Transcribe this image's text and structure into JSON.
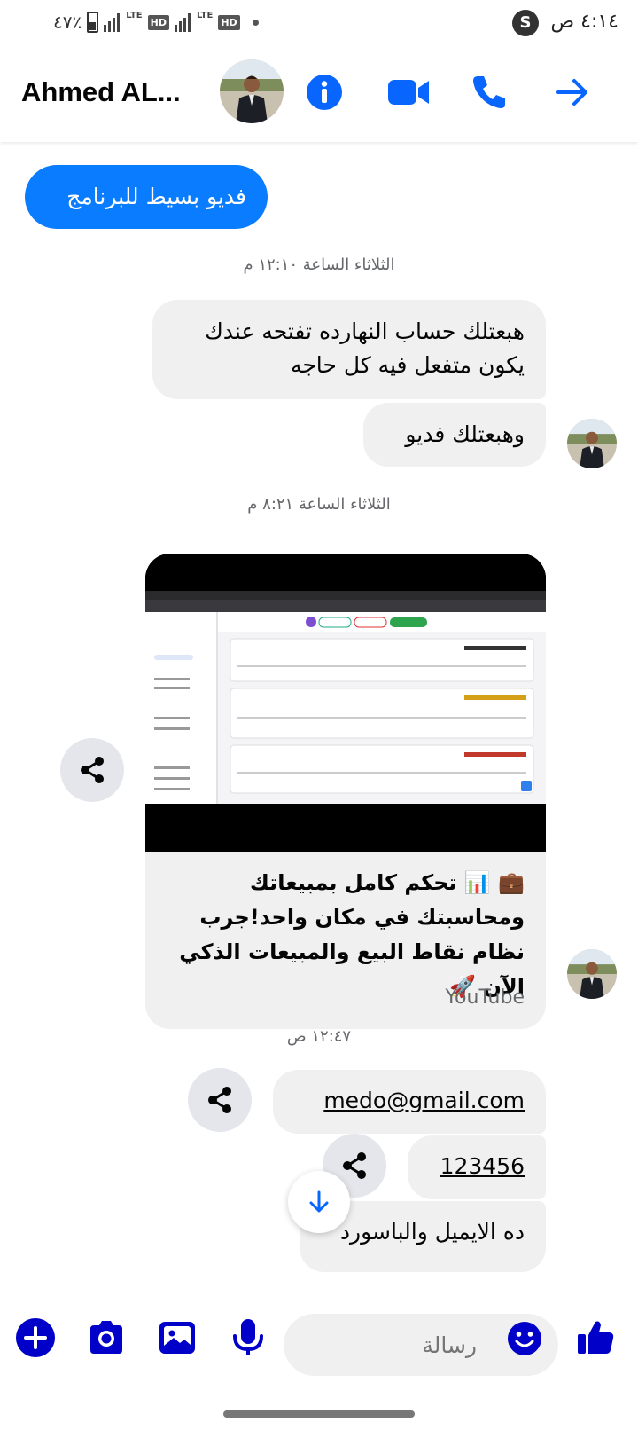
{
  "status_bar": {
    "time": "٤:١٤ ص",
    "battery_pct": "٤٧٪",
    "app_icon": "S",
    "net_labels": [
      "LTE",
      "HD",
      "LTE",
      "HD"
    ]
  },
  "header": {
    "contact_name": "Ahmed AL...",
    "icons": [
      "info-icon",
      "video-call-icon",
      "phone-icon",
      "arrow-right-icon"
    ]
  },
  "conversation": {
    "messages": [
      {
        "type": "sent",
        "text": "فديو بسيط للبرنامج"
      },
      {
        "type": "timestamp",
        "text": "الثلاثاء الساعة ١٢:١٠ م"
      },
      {
        "type": "received",
        "text": "هبعتلك حساب النهارده تفتحه عندك يكون متفعل فيه كل حاجه"
      },
      {
        "type": "received",
        "text": "وهبعتلك فديو"
      },
      {
        "type": "timestamp",
        "text": "الثلاثاء الساعة ٨:٢١ م"
      },
      {
        "type": "received_link",
        "text": "💼 📊 تحكم كامل بمبيعاتك ومحاسبتك في مكان واحد!جرب نظام نقاط البيع والمبيعات الذكي الآن 🚀",
        "source": "YouTube"
      },
      {
        "type": "timestamp",
        "text": "١٢:٤٧ ص"
      },
      {
        "type": "received",
        "text": "medo@gmail.com"
      },
      {
        "type": "received",
        "text": "123456"
      },
      {
        "type": "received",
        "text": "ده الايميل والباسورد"
      }
    ]
  },
  "composer": {
    "placeholder": "رسالة",
    "icons": [
      "add-icon",
      "camera-icon",
      "gallery-icon",
      "microphone-icon",
      "emoji-icon",
      "thumbs-up-icon"
    ]
  },
  "colors": {
    "accent": "#0a7cff",
    "icon_blue": "#0866ff",
    "composer_icon": "#0000c8",
    "bubble_received": "#f0f0f0"
  }
}
